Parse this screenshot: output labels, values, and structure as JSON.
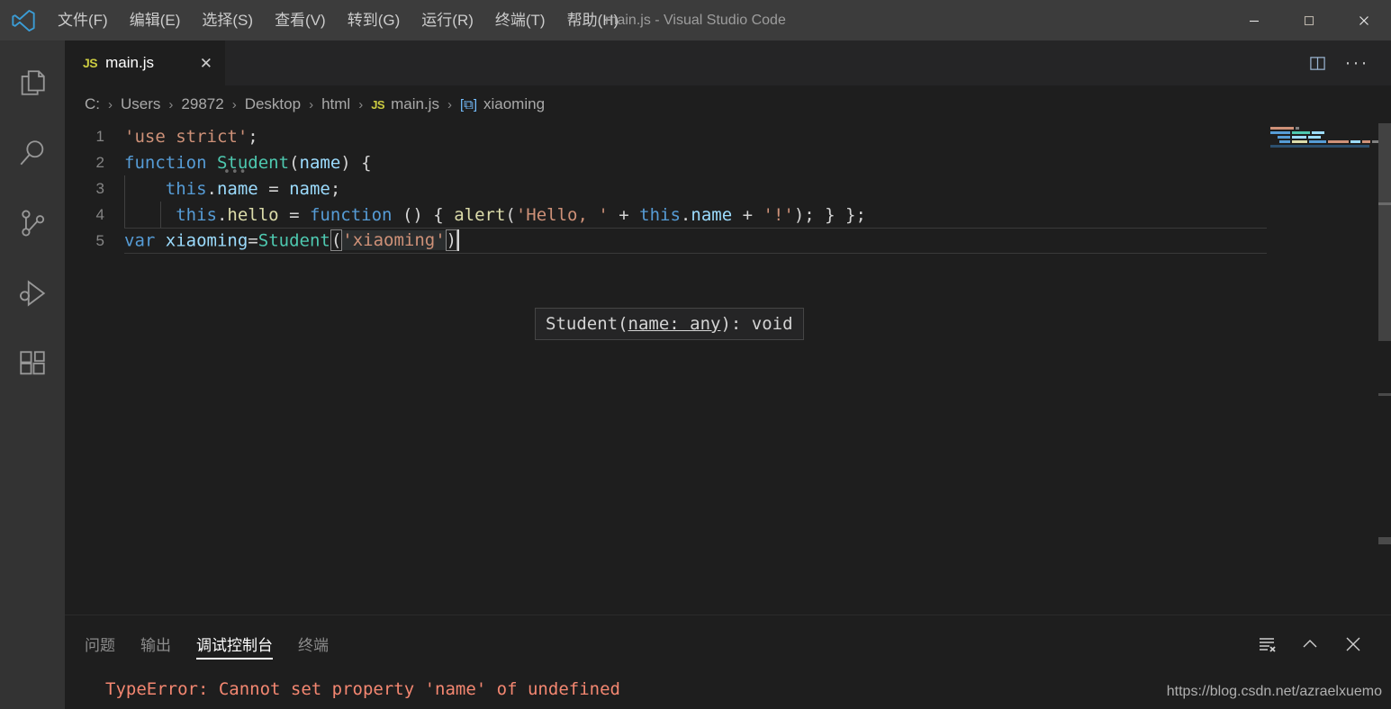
{
  "window": {
    "title": "main.js - Visual Studio Code",
    "logo_icon": "vscode-logo-icon",
    "minimize_icon": "minimize-icon",
    "maximize_icon": "maximize-icon",
    "close_icon": "close-icon"
  },
  "menubar": {
    "items": [
      {
        "label": "文件(F)",
        "name": "menu-file"
      },
      {
        "label": "编辑(E)",
        "name": "menu-edit"
      },
      {
        "label": "选择(S)",
        "name": "menu-selection"
      },
      {
        "label": "查看(V)",
        "name": "menu-view"
      },
      {
        "label": "转到(G)",
        "name": "menu-go"
      },
      {
        "label": "运行(R)",
        "name": "menu-run"
      },
      {
        "label": "终端(T)",
        "name": "menu-terminal"
      },
      {
        "label": "帮助(H)",
        "name": "menu-help"
      }
    ]
  },
  "activitybar": {
    "items": [
      {
        "name": "activitybar-explorer",
        "icon": "files-icon"
      },
      {
        "name": "activitybar-search",
        "icon": "search-icon"
      },
      {
        "name": "activitybar-source-control",
        "icon": "source-control-icon"
      },
      {
        "name": "activitybar-run-debug",
        "icon": "run-debug-icon"
      },
      {
        "name": "activitybar-extensions",
        "icon": "extensions-icon"
      }
    ]
  },
  "tabs": [
    {
      "filetype": "JS",
      "label": "main.js",
      "close": "✕",
      "active": true
    }
  ],
  "editor_actions": {
    "split_icon": "split-editor-icon",
    "more_label": "···"
  },
  "breadcrumb": {
    "separator": "›",
    "items": [
      {
        "label": "C:",
        "icon": ""
      },
      {
        "label": "Users",
        "icon": ""
      },
      {
        "label": "29872",
        "icon": ""
      },
      {
        "label": "Desktop",
        "icon": ""
      },
      {
        "label": "html",
        "icon": ""
      },
      {
        "label": "main.js",
        "icon": "JS"
      },
      {
        "label": "xiaoming",
        "icon": "symbol-variable-icon"
      }
    ]
  },
  "code": {
    "lines": [
      {
        "no": "1",
        "text": "'use strict';"
      },
      {
        "no": "2",
        "text": "function Student(name) {"
      },
      {
        "no": "3",
        "text": "    this.name = name;"
      },
      {
        "no": "4",
        "text": "     this.hello = function () { alert('Hello, ' + this.name + '!'); } };"
      },
      {
        "no": "5",
        "text": "var xiaoming=Student('xiaoming')"
      }
    ],
    "line4_visible_tail": "name + '!'); } };",
    "reference_hint": "…"
  },
  "signature_help": {
    "prefix": "Student(",
    "param": "name: any",
    "suffix": "): void"
  },
  "panel": {
    "tabs": [
      {
        "label": "问题",
        "name": "panel-tab-problems",
        "active": false
      },
      {
        "label": "输出",
        "name": "panel-tab-output",
        "active": false
      },
      {
        "label": "调试控制台",
        "name": "panel-tab-debug-console",
        "active": true
      },
      {
        "label": "终端",
        "name": "panel-tab-terminal",
        "active": false
      }
    ],
    "actions": [
      {
        "name": "clear-console-button",
        "icon": "clear-console-icon"
      },
      {
        "name": "maximize-panel-button",
        "icon": "chevron-up-icon"
      },
      {
        "name": "close-panel-button",
        "icon": "close-icon"
      }
    ],
    "console_output": "TypeError: Cannot set property 'name' of undefined"
  },
  "watermark": {
    "text": "https://blog.csdn.net/azraelxuemo"
  },
  "colors": {
    "titlebar_bg": "#3c3c3c",
    "activitybar_bg": "#333333",
    "editor_bg": "#1e1e1e",
    "tabbar_bg": "#252526",
    "error_text": "#f48771",
    "accent_blue": "#569cd6",
    "string_orange": "#ce9178",
    "type_green": "#4ec9b0",
    "function_yellow": "#dcdcaa",
    "variable_blue": "#9cdcfe",
    "js_yellow": "#cbcb41"
  }
}
